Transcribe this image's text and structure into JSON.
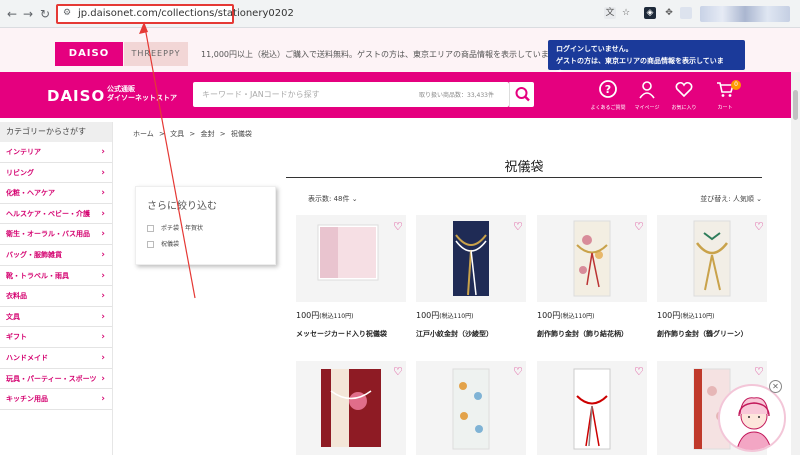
{
  "browser": {
    "back": "←",
    "forward": "→",
    "reload": "↻",
    "url": "jp.daisonet.com/collections/stationery0202"
  },
  "infobar": {
    "daiso_tab": "DAISO",
    "threeppy_tab": "THREEPPY",
    "notice": "11,000円以上（税込）ご購入で送料無料。ゲストの方は、東京エリアの商品情報を表示しています。",
    "login_line1": "ログインしていません。",
    "login_line2": "ゲストの方は、東京エリアの商品情報を表示しています。"
  },
  "header": {
    "logo": "DAISO",
    "store_line1": "公式通販",
    "store_line2": "ダイソーネットストア",
    "search_placeholder": "キーワード・JANコードから探す",
    "item_count": "取り扱い商品数：33,433件",
    "faq_label": "よくあるご質問",
    "mypage_label": "マイページ",
    "favorites_label": "お気に入り",
    "cart_label": "カート",
    "cart_count": "0"
  },
  "sidebar": {
    "heading": "カテゴリーからさがす",
    "items": [
      "インテリア",
      "リビング",
      "化粧・ヘアケア",
      "ヘルスケア・ベビー・介護",
      "衛生・オーラル・バス用品",
      "バッグ・服飾雑貨",
      "靴・トラベル・雨具",
      "衣料品",
      "文具",
      "ギフト",
      "ハンドメイド",
      "玩具・パーティー・スポーツ",
      "キッチン用品"
    ]
  },
  "breadcrumb": {
    "home": "ホーム",
    "sep": ">",
    "level1": "文具",
    "level2": "金封",
    "level3": "祝儀袋"
  },
  "page": {
    "title": "祝儀袋",
    "per_page": "表示数: 48件",
    "sort": "並び替え: 人気順"
  },
  "filter": {
    "title": "さらに絞り込む",
    "options": [
      "ポチ袋・年賀状",
      "祝儀袋"
    ]
  },
  "products": [
    {
      "price": "100円",
      "tax": "(税込110円)",
      "name": "メッセージカード入り祝儀袋"
    },
    {
      "price": "100円",
      "tax": "(税込110円)",
      "name": "江戸小紋金封（沙綾型）"
    },
    {
      "price": "100円",
      "tax": "(税込110円)",
      "name": "創作飾り金封（飾り結花柄）"
    },
    {
      "price": "100円",
      "tax": "(税込110円)",
      "name": "創作飾り金封（鶴グリーン）"
    }
  ],
  "chat": {
    "close": "✕"
  },
  "colors": {
    "brand_pink": "#e5007f",
    "login_blue": "#1b3a9a",
    "highlight_red": "#e53935"
  }
}
